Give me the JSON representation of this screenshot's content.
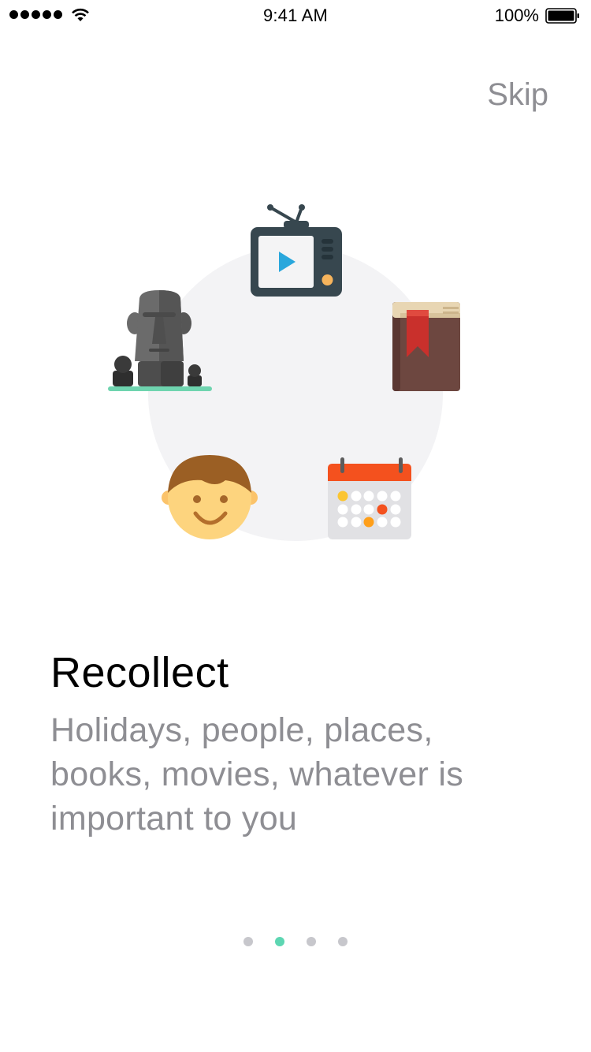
{
  "status_bar": {
    "time": "9:41 AM",
    "battery_percent": "100%",
    "signal_bars": 5,
    "icons": [
      "signal-icon",
      "wifi-icon",
      "battery-icon"
    ]
  },
  "header": {
    "skip_label": "Skip"
  },
  "illustration": {
    "icons": [
      "tv-icon",
      "book-icon",
      "calendar-icon",
      "face-icon",
      "moai-statue-icon"
    ]
  },
  "content": {
    "title": "Recollect",
    "description": "Holidays, people, places, books, movies, whatever is important to you"
  },
  "pagination": {
    "total": 4,
    "current": 2
  },
  "colors": {
    "accent": "#5dd6b2",
    "secondary_text": "#8e8e93",
    "inactive_dot": "#c7c7cc",
    "circle_bg": "#f3f3f5"
  }
}
